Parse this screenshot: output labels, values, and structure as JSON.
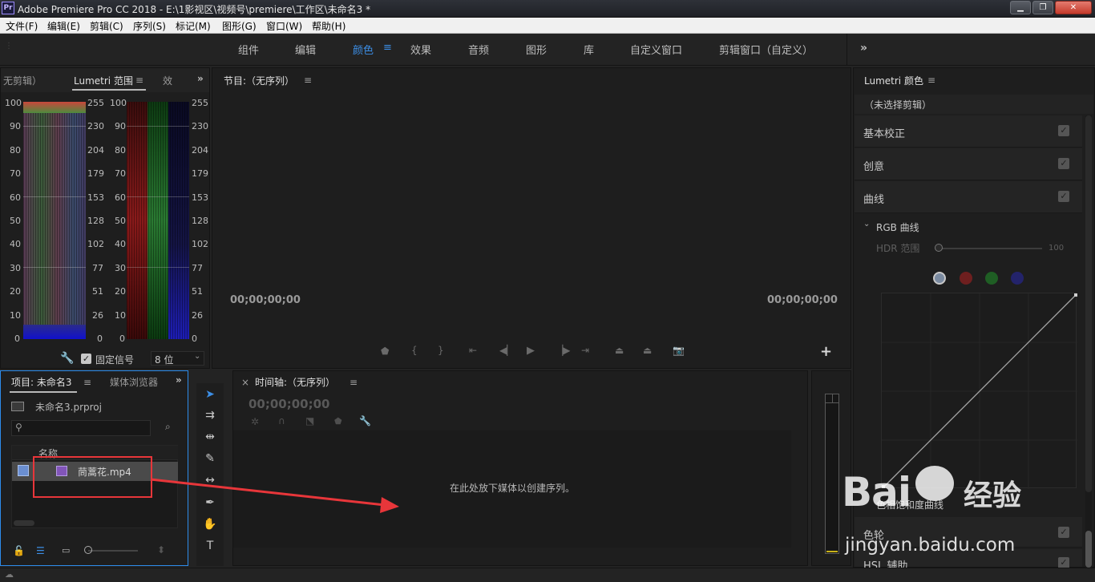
{
  "titlebar": {
    "app_icon": "Pr",
    "title": "Adobe Premiere Pro CC 2018 - E:\\1影视区\\视频号\\premiere\\工作区\\未命名3 *",
    "min": "▁",
    "max": "❐",
    "close": "✕"
  },
  "menu": [
    "文件(F)",
    "编辑(E)",
    "剪辑(C)",
    "序列(S)",
    "标记(M)",
    "图形(G)",
    "窗口(W)",
    "帮助(H)"
  ],
  "workspaces": {
    "tabs": [
      "组件",
      "编辑",
      "颜色",
      "效果",
      "音频",
      "图形",
      "库",
      "自定义窗口",
      "剪辑窗口（自定义）"
    ],
    "active": "颜色",
    "overflow": "»"
  },
  "scopes": {
    "tabs": [
      "无剪辑）",
      "Lumetri 范围",
      "效"
    ],
    "left_scale": [
      "100",
      "90",
      "80",
      "70",
      "60",
      "50",
      "40",
      "30",
      "20",
      "10",
      "0"
    ],
    "right_scale": [
      "255",
      "230",
      "204",
      "179",
      "153",
      "128",
      "102",
      "77",
      "51",
      "26",
      "0"
    ],
    "clamp_label": "固定信号",
    "bit_depth": "8 位"
  },
  "program": {
    "title": "节目:（无序列）",
    "tc_left": "00;00;00;00",
    "tc_right": "00;00;00;00",
    "add": "+"
  },
  "lumetri": {
    "title": "Lumetri 颜色",
    "no_clip": "（未选择剪辑）",
    "sections": [
      "基本校正",
      "创意",
      "曲线"
    ],
    "rgb_curves": "RGB 曲线",
    "hdr_label": "HDR 范围",
    "hdr_value": "100",
    "hue_sat": "色相饱和度曲线",
    "color_wheels": "色轮",
    "hsl": "HSL 辅助",
    "colors": {
      "white": "#c8c8c8",
      "red": "#6e1f1f",
      "green": "#1f5e24",
      "blue": "#23236a"
    }
  },
  "project": {
    "tabs": [
      "项目: 未命名3",
      "媒体浏览器"
    ],
    "file": "未命名3.prproj",
    "column_name": "名称",
    "item": "茼蒿花.mp4"
  },
  "timeline": {
    "title": "时间轴:（无序列）",
    "close": "×",
    "timecode": "00;00;00;00",
    "drop_hint": "在此处放下媒体以创建序列。"
  },
  "watermark": {
    "brand": "Bai",
    "brand2": "经验",
    "url": "jingyan.baidu.com"
  }
}
